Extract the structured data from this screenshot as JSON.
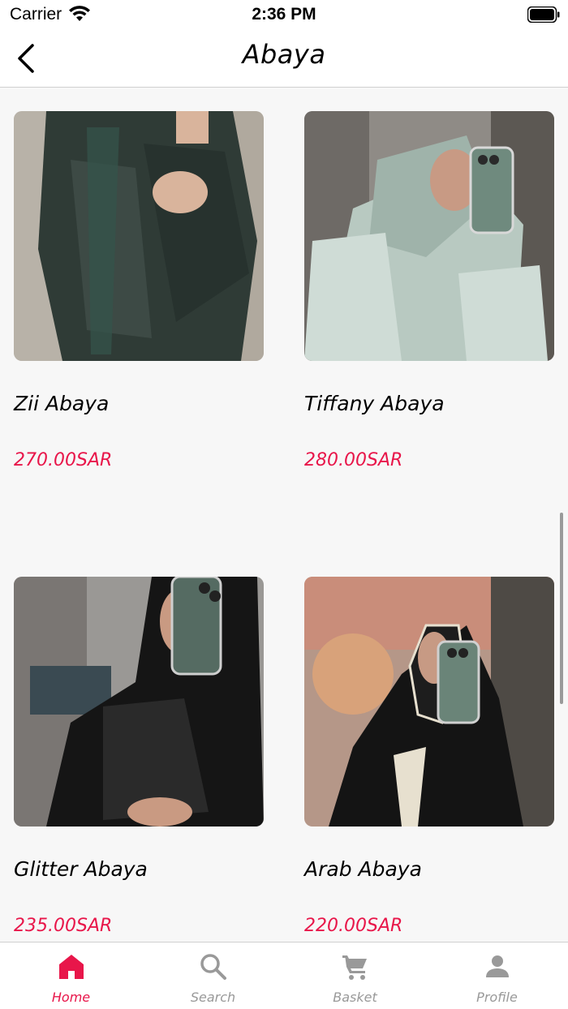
{
  "status_bar": {
    "carrier": "Carrier",
    "time": "2:36 PM"
  },
  "nav": {
    "title": "Abaya",
    "back_icon": "chevron-left-icon"
  },
  "products": [
    {
      "name": "Zii Abaya",
      "price": "270.00SAR"
    },
    {
      "name": "Tiffany Abaya",
      "price": "280.00SAR"
    },
    {
      "name": "Glitter Abaya",
      "price": "235.00SAR"
    },
    {
      "name": "Arab Abaya",
      "price": "220.00SAR"
    }
  ],
  "tabs": [
    {
      "label": "Home",
      "icon": "home-icon",
      "active": true
    },
    {
      "label": "Search",
      "icon": "search-icon",
      "active": false
    },
    {
      "label": "Basket",
      "icon": "cart-icon",
      "active": false
    },
    {
      "label": "Profile",
      "icon": "person-icon",
      "active": false
    }
  ],
  "colors": {
    "accent": "#e8164a",
    "inactive": "#999999",
    "background": "#f7f7f7"
  }
}
